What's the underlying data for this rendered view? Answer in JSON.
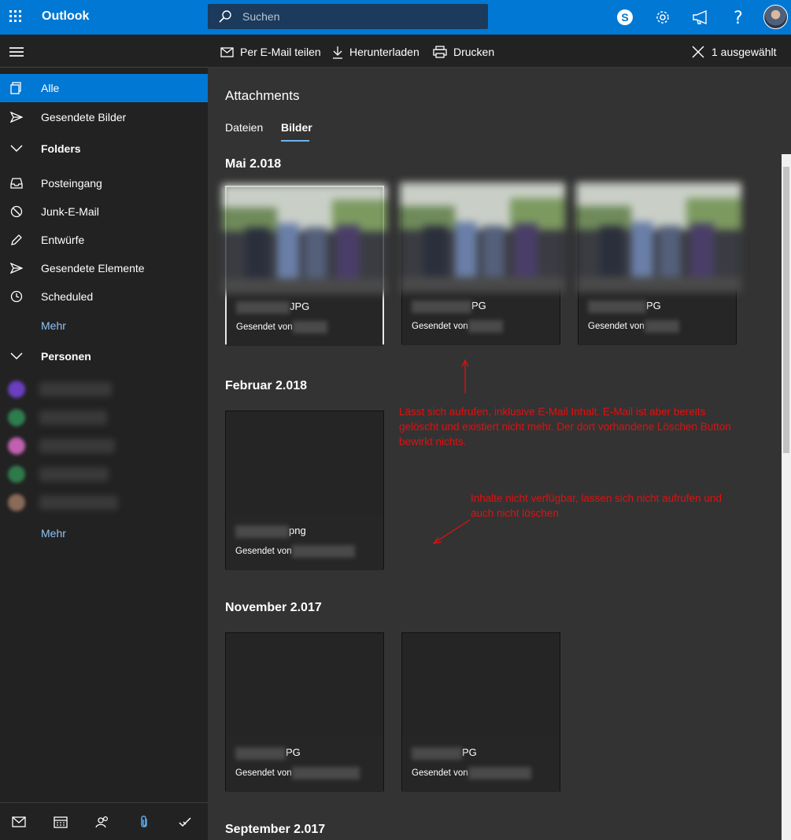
{
  "app": {
    "brand": "Outlook"
  },
  "search": {
    "placeholder": "Suchen"
  },
  "topbar": {
    "icons": [
      "skype-icon",
      "gear-icon",
      "megaphone-icon",
      "help-icon",
      "avatar"
    ]
  },
  "nav": {
    "items": [
      {
        "label": "Alle",
        "icon": "images-icon",
        "active": true
      },
      {
        "label": "Gesendete Bilder",
        "icon": "send-icon"
      }
    ],
    "folders_header": "Folders",
    "folders": [
      {
        "label": "Posteingang",
        "icon": "inbox-icon"
      },
      {
        "label": "Junk-E-Mail",
        "icon": "block-icon"
      },
      {
        "label": "Entwürfe",
        "icon": "pencil-icon"
      },
      {
        "label": "Gesendete Elemente",
        "icon": "send-icon"
      },
      {
        "label": "Scheduled",
        "icon": "clock-icon"
      }
    ],
    "more_folders": "Mehr",
    "people_header": "Personen",
    "more_people": "Mehr"
  },
  "commands": {
    "share": "Per E-Mail teilen",
    "download": "Herunterladen",
    "print": "Drucken",
    "selected": "1 ausgewählt"
  },
  "main": {
    "title": "Attachments",
    "tabs": [
      {
        "label": "Dateien"
      },
      {
        "label": "Bilder",
        "selected": true
      }
    ],
    "sections": [
      {
        "title": "Mai 2.018",
        "cards": [
          {
            "name_suffix": "JPG",
            "sender_prefix": "Gesendet von"
          },
          {
            "name_suffix": "PG",
            "sender_prefix": "Gesendet von"
          },
          {
            "name_suffix": "PG",
            "sender_prefix": "Gesendet von"
          }
        ]
      },
      {
        "title": "Februar 2.018",
        "cards": [
          {
            "name_suffix": "png",
            "sender_prefix": "Gesendet von"
          }
        ]
      },
      {
        "title": "November 2.017",
        "cards": [
          {
            "name_suffix": "PG",
            "sender_prefix": "Gesendet von"
          },
          {
            "name_suffix": "PG",
            "sender_prefix": "Gesendet von"
          }
        ]
      },
      {
        "title": "September 2.017",
        "cards": []
      }
    ]
  },
  "annotations": {
    "note1": "Lässt sich aufrufen, inklusive E-Mail Inhalt. E-Mail ist aber bereits gelöscht und existiert nicht mehr. Der dort vorhandene Löschen Button bewirkt nichts.",
    "note2": "Inhalte nicht verfügbar, lassen sich nicht aufrufen und auch nicht löschen",
    "color": "#e01010"
  },
  "colors": {
    "accent": "#0078d4",
    "link": "#8fc3f5"
  }
}
